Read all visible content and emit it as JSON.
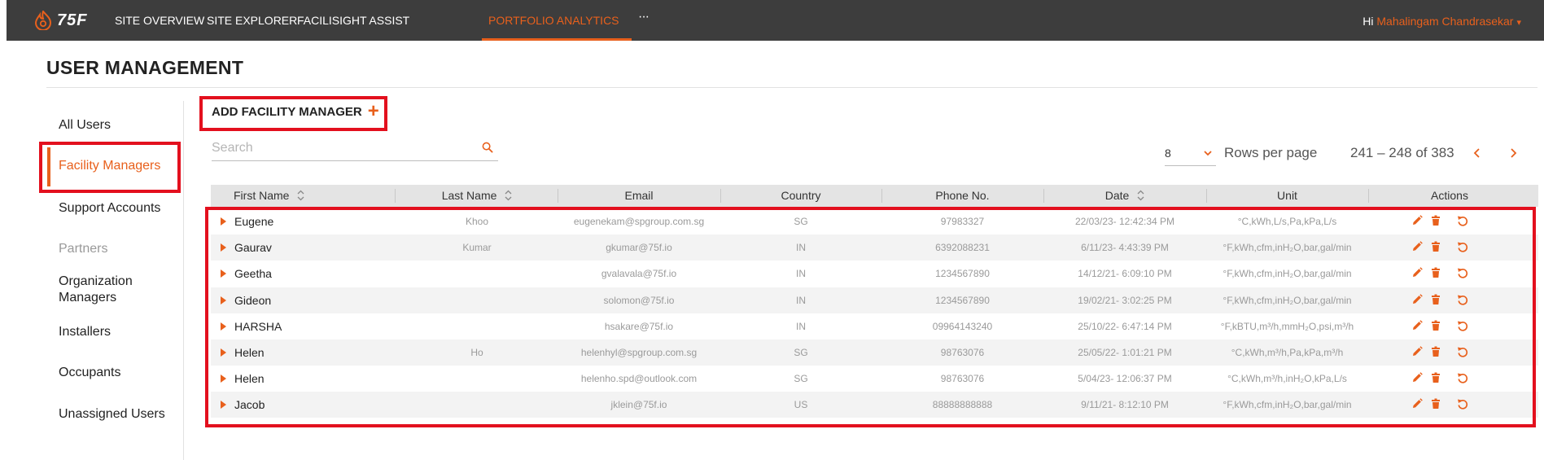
{
  "brand": {
    "logo_text": "75F",
    "accent": "#e8601c",
    "highlight": "#e3101e"
  },
  "nav": {
    "items": [
      {
        "label": "SITE OVERVIEW",
        "active": false
      },
      {
        "label": "SITE EXPLORER",
        "active": false
      },
      {
        "label": "FACILISIGHT ASSIST",
        "active": false
      },
      {
        "label": "PORTFOLIO ANALYTICS",
        "active": true
      }
    ],
    "more_label": "···",
    "greeting_prefix": "Hi",
    "user_name": "Mahalingam Chandrasekar"
  },
  "page": {
    "title": "USER MANAGEMENT"
  },
  "sidebar": {
    "items": [
      {
        "label": "All Users"
      },
      {
        "label": "Facility Managers",
        "active": true
      },
      {
        "label": "Support Accounts"
      },
      {
        "label": "Partners",
        "muted": true
      },
      {
        "label": "Organization Managers"
      },
      {
        "label": "Installers"
      },
      {
        "label": "Occupants"
      },
      {
        "label": "Unassigned Users"
      }
    ]
  },
  "toolbar": {
    "add_label": "ADD FACILITY MANAGER",
    "search_placeholder": "Search",
    "rows_per_page_value": "8",
    "rows_per_page_label": "Rows per page",
    "page_range": "241 – 248 of 383"
  },
  "table": {
    "columns": [
      "First Name",
      "Last Name",
      "Email",
      "Country",
      "Phone No.",
      "Date",
      "Unit",
      "Actions"
    ],
    "rows": [
      {
        "first": "Eugene",
        "last": "Khoo",
        "email": "eugenekam@spgroup.com.sg",
        "country": "SG",
        "phone": "97983327",
        "date": "22/03/23- 12:42:34 PM",
        "unit": "°C,kWh,L/s,Pa,kPa,L/s"
      },
      {
        "first": "Gaurav",
        "last": "Kumar",
        "email": "gkumar@75f.io",
        "country": "IN",
        "phone": "6392088231",
        "date": "6/11/23- 4:43:39 PM",
        "unit": "°F,kWh,cfm,inH₂O,bar,gal/min"
      },
      {
        "first": "Geetha",
        "last": "",
        "email": "gvalavala@75f.io",
        "country": "IN",
        "phone": "1234567890",
        "date": "14/12/21- 6:09:10 PM",
        "unit": "°F,kWh,cfm,inH₂O,bar,gal/min"
      },
      {
        "first": "Gideon",
        "last": "",
        "email": "solomon@75f.io",
        "country": "IN",
        "phone": "1234567890",
        "date": "19/02/21- 3:02:25 PM",
        "unit": "°F,kWh,cfm,inH₂O,bar,gal/min"
      },
      {
        "first": "HARSHA",
        "last": "",
        "email": "hsakare@75f.io",
        "country": "IN",
        "phone": "09964143240",
        "date": "25/10/22- 6:47:14 PM",
        "unit": "°F,kBTU,m³/h,mmH₂O,psi,m³/h"
      },
      {
        "first": "Helen",
        "last": "Ho",
        "email": "helenhyl@spgroup.com.sg",
        "country": "SG",
        "phone": "98763076",
        "date": "25/05/22- 1:01:21 PM",
        "unit": "°C,kWh,m³/h,Pa,kPa,m³/h"
      },
      {
        "first": "Helen",
        "last": "",
        "email": "helenho.spd@outlook.com",
        "country": "SG",
        "phone": "98763076",
        "date": "5/04/23- 12:06:37 PM",
        "unit": "°C,kWh,m³/h,inH₂O,kPa,L/s"
      },
      {
        "first": "Jacob",
        "last": "",
        "email": "jklein@75f.io",
        "country": "US",
        "phone": "88888888888",
        "date": "9/11/21- 8:12:10 PM",
        "unit": "°F,kWh,cfm,inH₂O,bar,gal/min"
      }
    ]
  }
}
